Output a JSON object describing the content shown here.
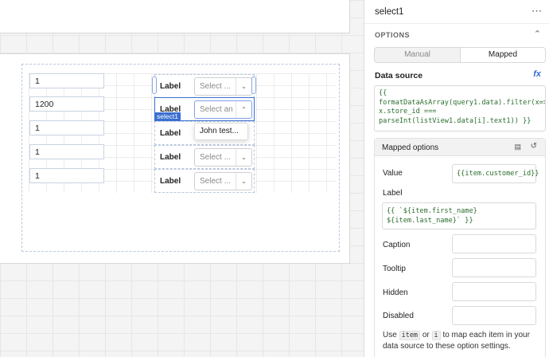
{
  "canvas": {
    "num_values": [
      "1",
      "1200",
      "1",
      "1",
      "1"
    ],
    "rows": [
      {
        "label": "Label",
        "placeholder": "Select ..."
      },
      {
        "label": "Label",
        "placeholder": "Select an"
      },
      {
        "label": "Label",
        "placeholder": ""
      },
      {
        "label": "Label",
        "placeholder": "Select ..."
      },
      {
        "label": "Label",
        "placeholder": "Select ..."
      }
    ],
    "selected_badge": "select1",
    "dropdown_option": "John test..."
  },
  "inspector": {
    "component_name": "select1",
    "more_icon": "more-horizontal-icon",
    "section_title": "OPTIONS",
    "mode_manual": "Manual",
    "mode_mapped": "Mapped",
    "active_mode": "Mapped",
    "data_source_label": "Data source",
    "fx_label": "fx",
    "data_source_code": "{{\nformatDataAsArray(query1.data).filter(x=>\nx.store_id ===\nparseInt(listView1.data[i].text1)) }}",
    "mapped_options_title": "Mapped options",
    "value_label": "Value",
    "value_code": "{{item.customer_id}}",
    "label_label": "Label",
    "label_code": "{{ `${item.first_name}\n${item.last_name}` }}",
    "caption_label": "Caption",
    "tooltip_label": "Tooltip",
    "hidden_label": "Hidden",
    "disabled_label": "Disabled",
    "help_use": "Use",
    "help_item": "item",
    "help_or": "or",
    "help_i": "i",
    "help_rest": "to map each item in your data source to these option settings.",
    "accent_color": "#3a6fd1"
  }
}
